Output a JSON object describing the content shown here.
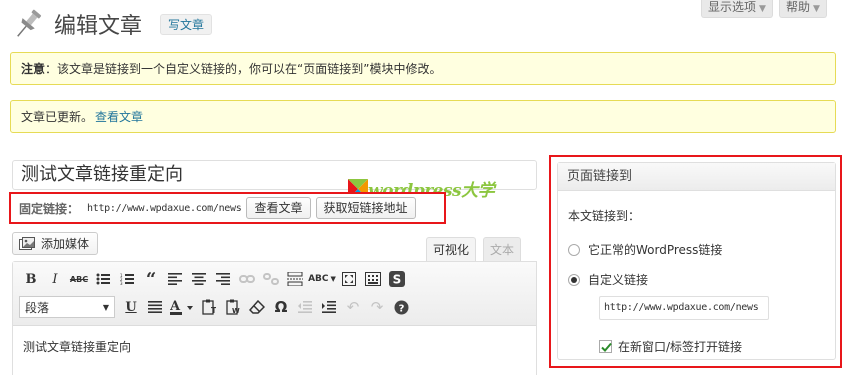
{
  "header": {
    "title": "编辑文章",
    "add_new_label": "写文章",
    "screen_options_label": "显示选项",
    "help_label": "帮助"
  },
  "notices": {
    "note_prefix": "注意",
    "note_text": "：该文章是链接到一个自定义链接的，你可以在“页面链接到”模块中修改。",
    "updated_text": "文章已更新。",
    "view_post_link": "查看文章"
  },
  "post": {
    "title": "测试文章链接重定向",
    "permalink_label": "固定链接：",
    "permalink_url": "http://www.wpdaxue.com/news",
    "view_post_button": "查看文章",
    "get_shortlink_button": "获取短链接地址"
  },
  "watermark": {
    "text": "wordpress大学"
  },
  "editor": {
    "add_media_label": "添加媒体",
    "tab_visual": "可视化",
    "tab_html": "文本",
    "format_select": "段落",
    "content": "测试文章链接重定向"
  },
  "redirect_box": {
    "title": "页面链接到",
    "subtitle": "本文链接到：",
    "option_normal": "它正常的WordPress链接",
    "option_custom": "自定义链接",
    "custom_url": "http://www.wpdaxue.com/news",
    "new_window_label": "在新窗口/标签打开链接",
    "selected_option": "custom",
    "new_window_checked": true
  },
  "colors": {
    "link": "#21759b",
    "notice_bg": "#ffffe0",
    "notice_border": "#e6db55",
    "highlight_red": "#e8161a",
    "watermark_green": "#8cc63f"
  }
}
